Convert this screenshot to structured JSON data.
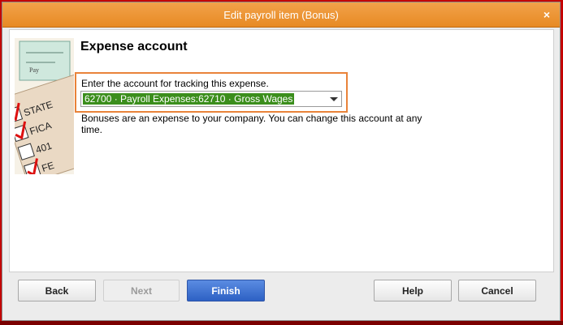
{
  "window": {
    "title": "Edit payroll item (Bonus)",
    "close_symbol": "×"
  },
  "page": {
    "heading": "Expense account",
    "instruction": "Enter the account for tracking this expense.",
    "account_value": "62700 · Payroll Expenses:62710 · Gross Wages",
    "help_text": "Bonuses are an expense to your company. You can change this account at any time."
  },
  "illustration": {
    "checklist": [
      "STATE",
      "FICA",
      "401",
      "FE"
    ]
  },
  "buttons": {
    "back": "Back",
    "next": "Next",
    "finish": "Finish",
    "help": "Help",
    "cancel": "Cancel"
  },
  "colors": {
    "title_bar": "#e78a24",
    "highlight_border": "#e9833a",
    "selection_green": "#3b8e1c",
    "primary_button": "#2d61c4",
    "outer_frame": "#c40000"
  }
}
